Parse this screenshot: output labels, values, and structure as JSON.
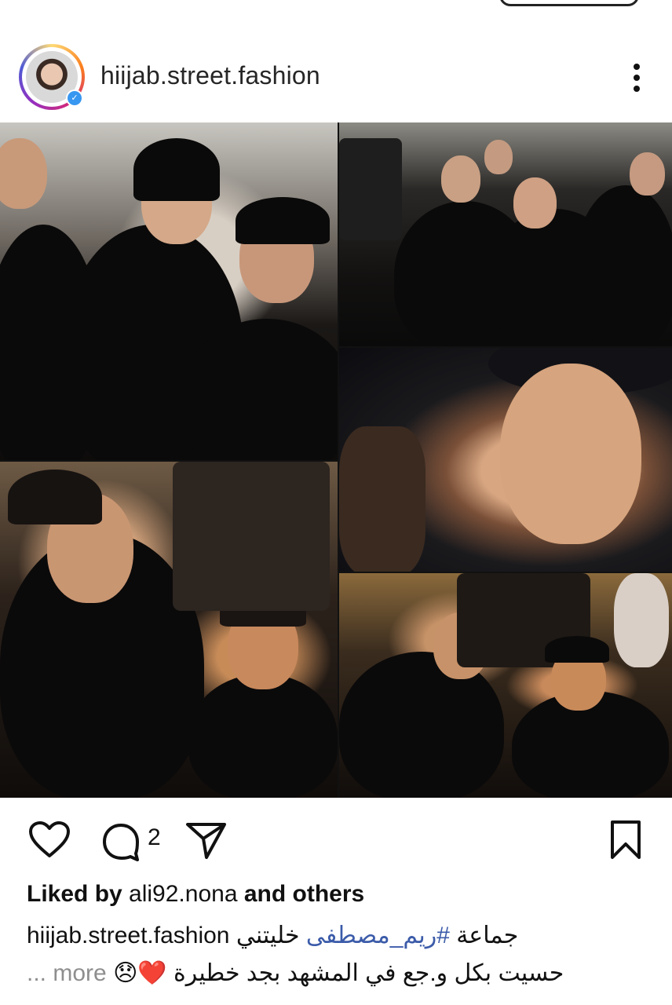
{
  "header": {
    "username": "hiijab.street.fashion",
    "verified_badge": "✓"
  },
  "actions": {
    "comment_count": "2"
  },
  "likes": {
    "prefix": "Liked by",
    "user": "ali92.nona",
    "suffix": "and others"
  },
  "caption": {
    "line1_arabic_start": "جماعة",
    "hashtag": "#ريم_مصطفى",
    "line1_arabic_end": "خليتني",
    "username": "hiijab.street.fashion",
    "line2_text": "حسيت بكل و.جع في المشهد بجد خطيرة",
    "emojis": "😞❤️",
    "more_prefix": "...",
    "more_label": "more"
  },
  "icons": {
    "heart": "heart-icon",
    "comment": "comment-icon",
    "share": "share-icon",
    "bookmark": "bookmark-icon",
    "more": "more-dots-icon"
  },
  "colors": {
    "hashtag": "#3b5ba9",
    "muted": "#8e8e8e",
    "verified": "#3897f0"
  }
}
